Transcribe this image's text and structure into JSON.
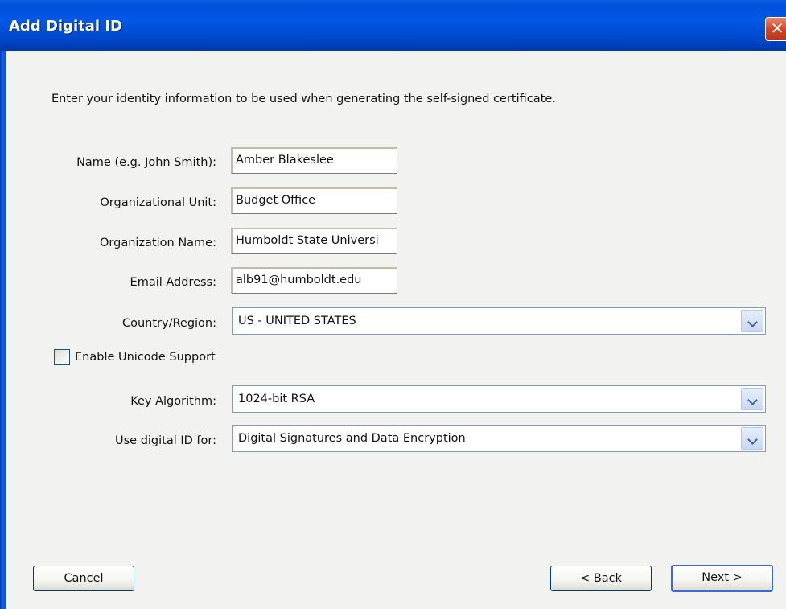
{
  "window": {
    "title": "Add Digital ID",
    "close_glyph": "✕"
  },
  "intro_text": "Enter your identity information to be used when generating the self-signed certificate.",
  "fields": {
    "name": {
      "label": "Name (e.g. John Smith):",
      "value": "Amber Blakeslee"
    },
    "org_unit": {
      "label": "Organizational Unit:",
      "value": "Budget Office"
    },
    "org_name": {
      "label": "Organization Name:",
      "value": "Humboldt State Universi"
    },
    "email": {
      "label": "Email Address:",
      "value": "alb91@humboldt.edu"
    }
  },
  "country": {
    "label": "Country/Region:",
    "value": "US - UNITED STATES"
  },
  "unicode": {
    "label": "Enable Unicode Support",
    "checked": false
  },
  "key_algorithm": {
    "label": "Key Algorithm:",
    "value": "1024-bit RSA"
  },
  "usage": {
    "label": "Use digital ID for:",
    "value": "Digital Signatures and Data Encryption"
  },
  "buttons": {
    "cancel": "Cancel",
    "back": "< Back",
    "next": "Next >"
  },
  "icons": {
    "close": "close-icon",
    "dropdown": "chevron-down-icon",
    "checkbox": "checkbox-unchecked-icon"
  },
  "colors": {
    "titlebar": "#0050dc",
    "close_button": "#d4482a",
    "dialog_background": "#f2f2f0"
  }
}
